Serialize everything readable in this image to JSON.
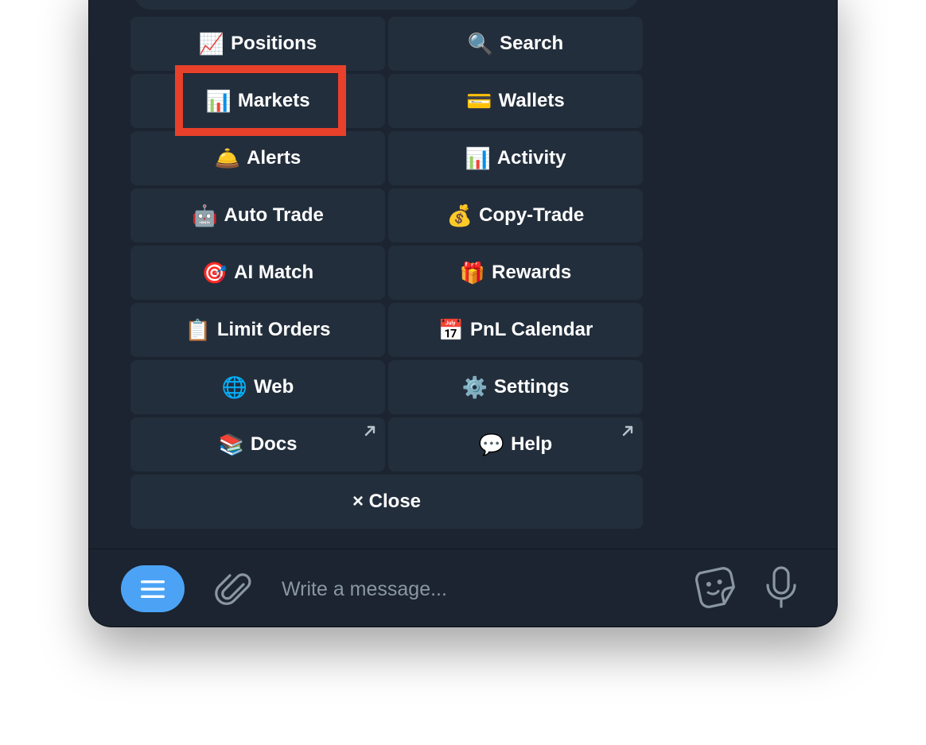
{
  "keyboard": {
    "rows": [
      [
        {
          "emoji": "📈",
          "label": "Positions"
        },
        {
          "emoji": "🔍",
          "label": "Search"
        }
      ],
      [
        {
          "emoji": "📊",
          "label": "Markets"
        },
        {
          "emoji": "💳",
          "label": "Wallets"
        }
      ],
      [
        {
          "emoji": "🛎️",
          "label": "Alerts"
        },
        {
          "emoji": "📊",
          "label": "Activity"
        }
      ],
      [
        {
          "emoji": "🤖",
          "label": "Auto Trade"
        },
        {
          "emoji": "💰",
          "label": "Copy-Trade"
        }
      ],
      [
        {
          "emoji": "🎯",
          "label": "AI Match"
        },
        {
          "emoji": "🎁",
          "label": "Rewards"
        }
      ],
      [
        {
          "emoji": "📋",
          "label": "Limit Orders"
        },
        {
          "emoji": "📅",
          "label": "PnL Calendar"
        }
      ],
      [
        {
          "emoji": "🌐",
          "label": "Web"
        },
        {
          "emoji": "⚙️",
          "label": "Settings"
        }
      ],
      [
        {
          "emoji": "📚",
          "label": "Docs"
        },
        {
          "emoji": "💬",
          "label": "Help"
        }
      ]
    ],
    "close_label": "× Close"
  },
  "input": {
    "placeholder": "Write a message..."
  },
  "icons": {
    "menu": "menu-icon",
    "attach": "paperclip-icon",
    "sticker": "sticker-icon",
    "mic": "microphone-icon",
    "external": "arrow-up-right-icon"
  },
  "colors": {
    "background": "#1b2430",
    "button": "#232e3c",
    "accent": "#4ca3f5",
    "highlight": "#e8402a"
  }
}
